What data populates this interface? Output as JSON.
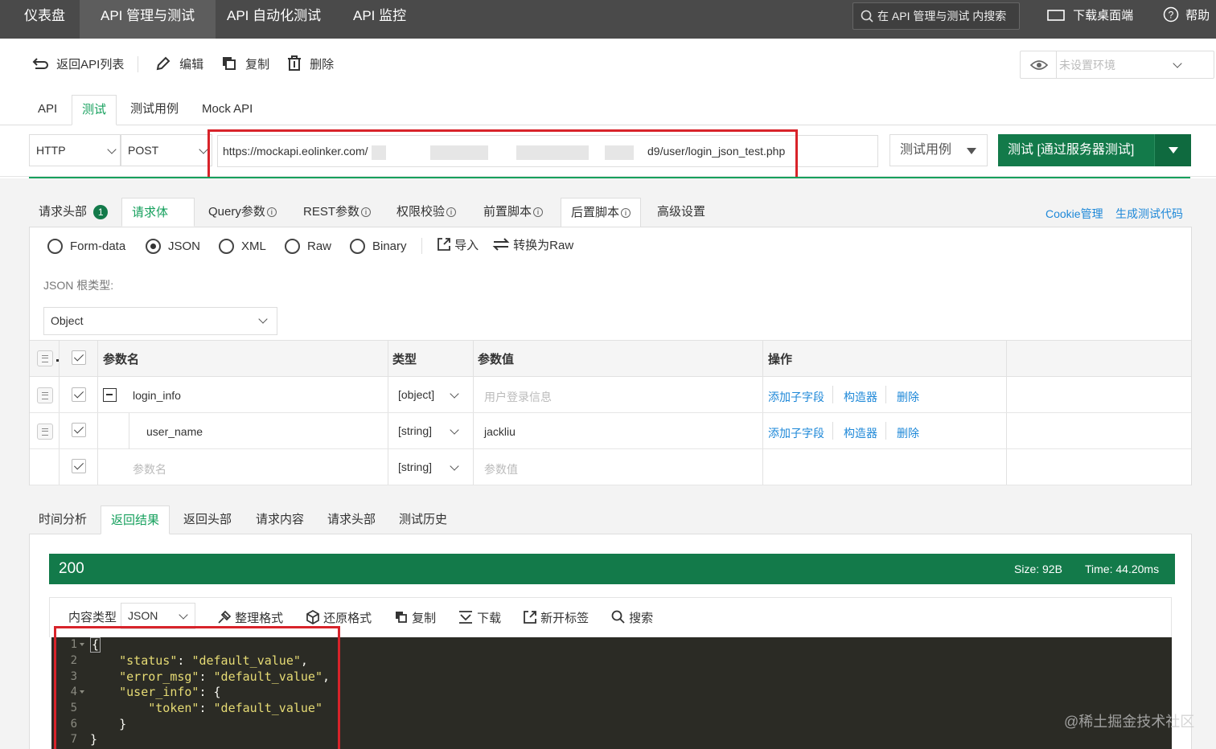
{
  "topnav": {
    "items": [
      "仪表盘",
      "API 管理与测试",
      "API 自动化测试",
      "API 监控"
    ],
    "search_placeholder": "在 API 管理与测试 内搜索",
    "download": "下载桌面端",
    "help": "帮助"
  },
  "toolbar": {
    "back": "返回API列表",
    "edit": "编辑",
    "copy": "复制",
    "delete": "删除",
    "env_placeholder": "未设置环境"
  },
  "api_tabs": [
    "API",
    "测试",
    "测试用例",
    "Mock API"
  ],
  "request": {
    "protocol": "HTTP",
    "method": "POST",
    "url_prefix": "https://mockapi.eolinker.com/",
    "url_suffix": "d9/user/login_json_test.php",
    "testcase_select": "测试用例",
    "test_button": "测试 [通过服务器测试]"
  },
  "req_tabs": {
    "headers": "请求头部",
    "headers_badge": "1",
    "body": "请求体",
    "query": "Query参数",
    "rest": "REST参数",
    "auth": "权限校验",
    "pre": "前置脚本",
    "post": "后置脚本",
    "advanced": "高级设置",
    "info_glyph": "i",
    "cookie": "Cookie管理",
    "gencode": "生成测试代码"
  },
  "body": {
    "types": [
      "Form-data",
      "JSON",
      "XML",
      "Raw",
      "Binary"
    ],
    "selected": "JSON",
    "import": "导入",
    "convert": "转换为Raw",
    "root_label": "JSON 根类型:",
    "root_value": "Object"
  },
  "table": {
    "headers": [
      "参数名",
      "类型",
      "参数值",
      "操作"
    ],
    "rows": [
      {
        "name": "login_info",
        "type": "[object]",
        "value": "用户登录信息",
        "value_placeholder": true
      },
      {
        "name": "user_name",
        "type": "[string]",
        "value": "jackliu",
        "value_placeholder": false
      },
      {
        "name": "参数名",
        "type": "[string]",
        "value": "参数值",
        "value_placeholder": true
      }
    ],
    "ops": [
      "添加子字段",
      "构造器",
      "删除"
    ]
  },
  "result_tabs": [
    "时间分析",
    "返回结果",
    "返回头部",
    "请求内容",
    "请求头部",
    "测试历史"
  ],
  "result": {
    "status": "200",
    "size": "Size: 92B",
    "time": "Time: 44.20ms",
    "content_type_label": "内容类型",
    "content_type": "JSON",
    "tools": [
      "整理格式",
      "还原格式",
      "复制",
      "下载",
      "新开标签",
      "搜索"
    ],
    "line_numbers": [
      "1",
      "2",
      "3",
      "4",
      "5",
      "6",
      "7"
    ],
    "code": {
      "open": "{",
      "k1": "\"status\"",
      "v1": "\"default_value\"",
      "k2": "\"error_msg\"",
      "v2": "\"default_value\"",
      "k3": "\"user_info\"",
      "k4": "\"token\"",
      "v4": "\"default_value\"",
      "close_inner": "}",
      "close": "}"
    }
  },
  "watermark": "@稀土掘金技术社区",
  "colors": {
    "brand_green": "#137a4a",
    "accent_green": "#16a05d",
    "link_blue": "#1e88d8",
    "highlight_red": "#d8232a",
    "nav_bg": "#4a4a4a"
  }
}
